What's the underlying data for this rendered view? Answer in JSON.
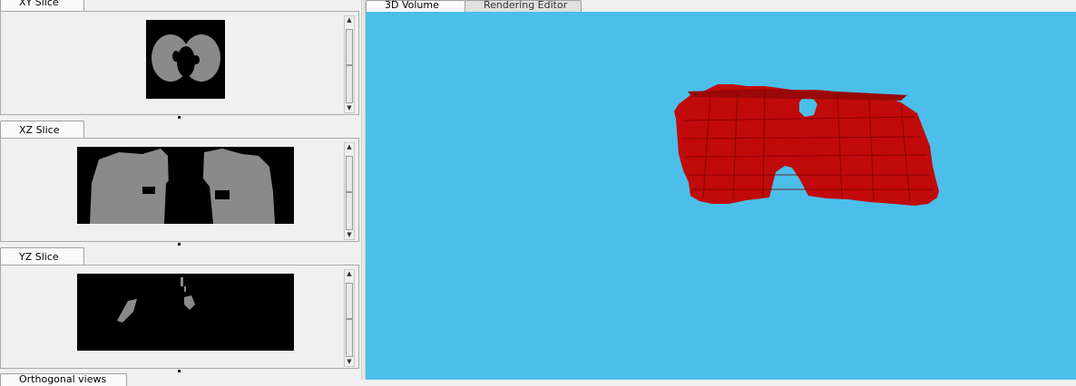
{
  "left_panels": {
    "xy": {
      "tab": "XY Slice"
    },
    "xz": {
      "tab": "XZ Slice"
    },
    "yz": {
      "tab": "YZ Slice"
    },
    "bottom": {
      "tab": "Orthogonal views"
    }
  },
  "right_tabs": {
    "volume": "3D Volume",
    "rendering": "Rendering Editor"
  },
  "colors": {
    "viewport_bg": "#4bbfe9",
    "mesh": "#c10a0a",
    "slice_bg": "#000000",
    "tissue": "#8a8a8a"
  }
}
